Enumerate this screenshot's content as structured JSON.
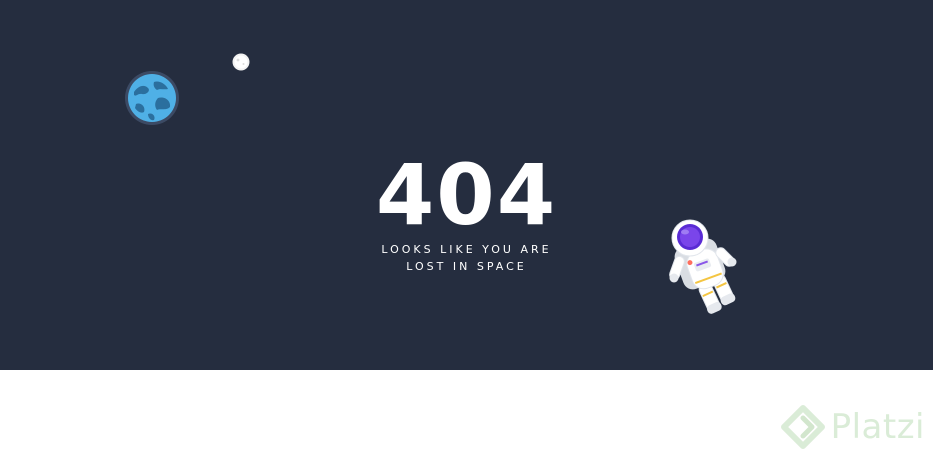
{
  "error": {
    "code": "404",
    "message_line1": "LOOKS LIKE YOU ARE",
    "message_line2": "LOST IN SPACE"
  },
  "brand": {
    "name": "Platzi"
  },
  "colors": {
    "space_background": "#252d3f",
    "footer_background": "#ffffff",
    "text": "#ffffff",
    "brand_accent": "#98c98f"
  },
  "icons": {
    "earth": "earth-icon",
    "moon": "moon-icon",
    "astronaut": "astronaut-icon",
    "brand_logo": "platzi-logo-icon"
  }
}
